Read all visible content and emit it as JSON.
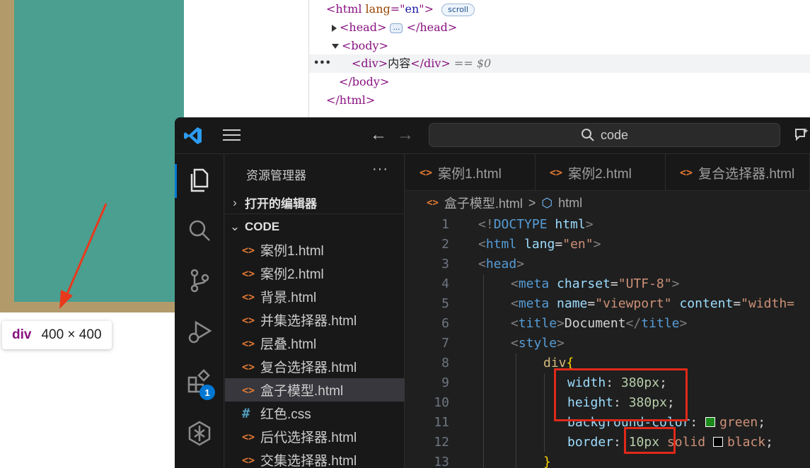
{
  "preview": {
    "tooltip_tag": "div",
    "tooltip_size": "400 × 400",
    "colors": {
      "border": "#b39a6b",
      "box": "#4a9f90",
      "arrow": "#e8391d"
    }
  },
  "devtools": {
    "line1": {
      "open": "<html",
      "attr": "lang",
      "eq": "=\"",
      "val": "en",
      "close": "\">",
      "badge": "scroll"
    },
    "line2": {
      "open": "<head>",
      "ellipsis": "…",
      "close": "</head>"
    },
    "line3": {
      "open": "<body>"
    },
    "line4": {
      "dots": "•••",
      "open": "<div>",
      "text": "内容",
      "close": "</div>",
      "ref": " == $0"
    },
    "line5": {
      "close": "</body>"
    },
    "line6": {
      "close": "</html>"
    }
  },
  "vscode": {
    "search": "code",
    "badge_count": "1",
    "sidebar": {
      "title": "资源管理器",
      "more": "···",
      "open_editors": "打开的编辑器",
      "folder": "CODE",
      "files": [
        {
          "icon": "<>",
          "name": "案例1.html"
        },
        {
          "icon": "<>",
          "name": "案例2.html"
        },
        {
          "icon": "<>",
          "name": "背景.html"
        },
        {
          "icon": "<>",
          "name": "并集选择器.html"
        },
        {
          "icon": "<>",
          "name": "层叠.html"
        },
        {
          "icon": "<>",
          "name": "复合选择器.html"
        },
        {
          "icon": "<>",
          "name": "盒子模型.html"
        },
        {
          "icon": "#",
          "name": "红色.css"
        },
        {
          "icon": "<>",
          "name": "后代选择器.html"
        },
        {
          "icon": "<>",
          "name": "交集选择器.html"
        }
      ]
    },
    "tabs": [
      {
        "icon": "<>",
        "label": "案例1.html"
      },
      {
        "icon": "<>",
        "label": "案例2.html"
      },
      {
        "icon": "<>",
        "label": "复合选择器.html"
      }
    ],
    "breadcrumb": {
      "file": "盒子模型.html",
      "sep": ">",
      "symbol": "html"
    },
    "line_numbers": [
      "1",
      "2",
      "3",
      "4",
      "5",
      "6",
      "7",
      "8",
      "9",
      "10",
      "11",
      "12",
      "13"
    ],
    "code": {
      "l1": {
        "a": "<!",
        "b": "DOCTYPE",
        "c": " html",
        "d": ">"
      },
      "l2": {
        "a": "<",
        "b": "html",
        "c": " lang",
        "d": "=",
        "e": "\"en\"",
        "f": ">"
      },
      "l3": {
        "a": "<",
        "b": "head",
        "c": ">"
      },
      "l4": {
        "a": "<",
        "b": "meta",
        "c": " charset",
        "d": "=",
        "e": "\"UTF-8\"",
        "f": ">"
      },
      "l5": {
        "a": "<",
        "b": "meta",
        "c": " name",
        "d": "=",
        "e": "\"viewport\"",
        "f": " content",
        "g": "=",
        "h": "\"width="
      },
      "l6": {
        "a": "<",
        "b": "title",
        "c": ">",
        "d": "Document",
        "e": "</",
        "f": "title",
        "g": ">"
      },
      "l7": {
        "a": "<",
        "b": "style",
        "c": ">"
      },
      "l8": {
        "a": "div",
        "b": "{"
      },
      "l9": {
        "a": "width",
        "b": ": ",
        "c": "380px",
        "d": ";"
      },
      "l10": {
        "a": "height",
        "b": ": ",
        "c": "380px",
        "d": ";"
      },
      "l11": {
        "a": "background-color",
        "b": ": ",
        "c": "green",
        "d": ";",
        "swatch": "#1a8a1a"
      },
      "l12": {
        "a": "border",
        "b": ": ",
        "c": "10px",
        "d": " solid ",
        "e": "black",
        "f": ";",
        "swatch": "#000000"
      },
      "l13": {
        "a": "}"
      }
    }
  }
}
